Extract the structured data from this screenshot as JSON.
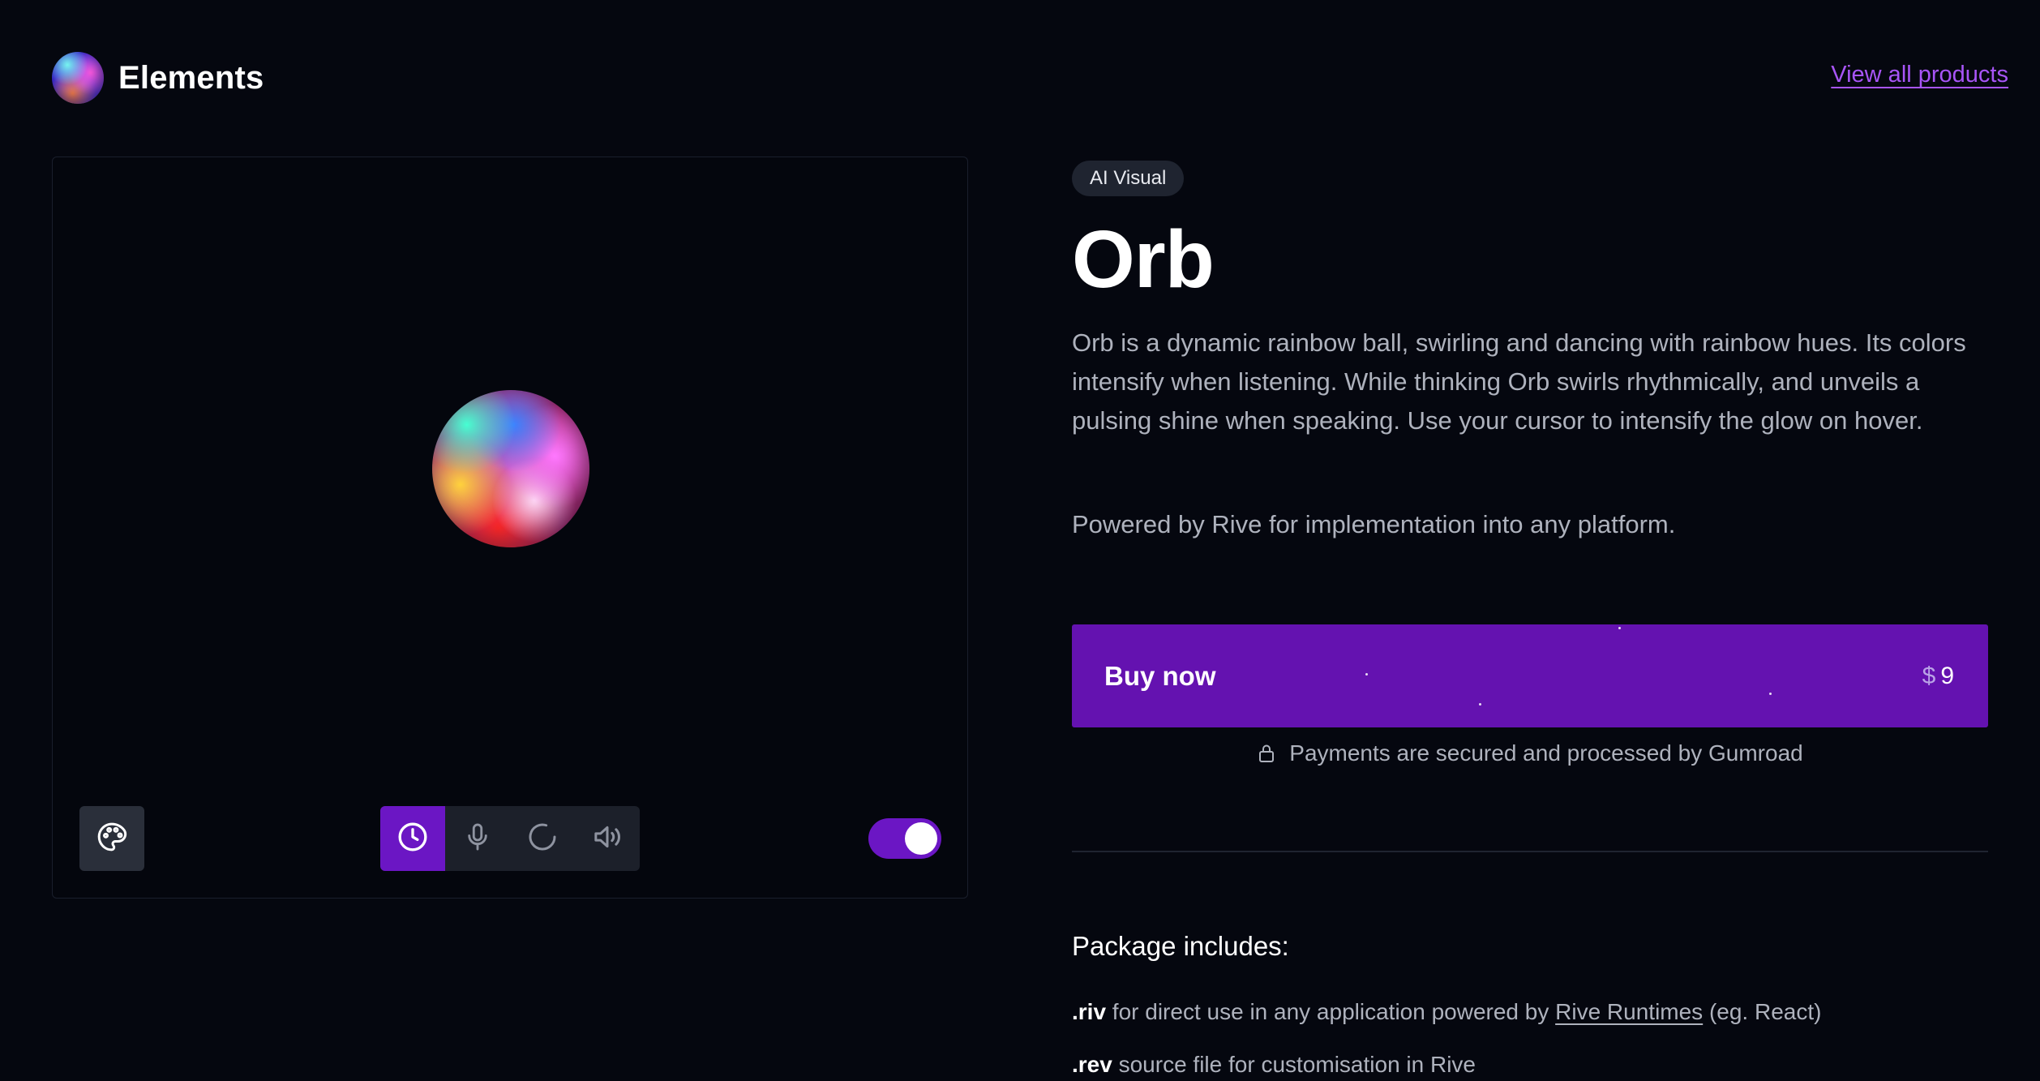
{
  "header": {
    "brand_name": "Elements",
    "view_all_label": "View all products"
  },
  "preview": {
    "state_buttons": [
      "clock-icon",
      "mic-icon",
      "spinner-icon",
      "speaker-icon"
    ],
    "active_state": "clock-icon",
    "toggle_on": true
  },
  "product": {
    "tag": "AI Visual",
    "title": "Orb",
    "description": "Orb is a dynamic rainbow ball, swirling and dancing with rainbow hues. Its colors intensify when listening. While thinking Orb swirls rhythmically, and unveils a pulsing shine when speaking. Use your cursor to intensify the glow on hover.",
    "powered_by": "Powered by Rive for implementation into any platform."
  },
  "purchase": {
    "buy_label": "Buy now",
    "currency": "$",
    "price": "9",
    "secure_text": "Payments are secured and processed by Gumroad"
  },
  "package": {
    "title": "Package includes:",
    "items": [
      {
        "key": ".riv",
        "text_before": " for direct use in any application powered by ",
        "link": "Rive Runtimes",
        "text_after": " (eg. React)"
      },
      {
        "key": ".rev",
        "text_before": " source file for customisation in Rive",
        "link": "",
        "text_after": ""
      }
    ]
  },
  "colors": {
    "background": "#05070f",
    "accent": "#6b16c4",
    "buy_button": "#6412b0",
    "link": "#a855f7",
    "muted_text": "#aeb2bd"
  }
}
